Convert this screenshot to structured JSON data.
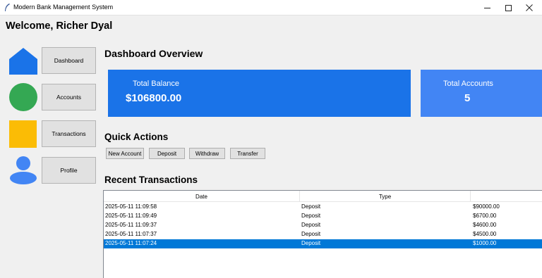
{
  "window": {
    "title": "Modern Bank Management System"
  },
  "welcome": "Welcome, Richer Dyal",
  "sidebar": {
    "items": [
      {
        "label": "Dashboard",
        "icon": "home-icon",
        "color": "#1a73e8"
      },
      {
        "label": "Accounts",
        "icon": "circle-icon",
        "color": "#34a853"
      },
      {
        "label": "Transactions",
        "icon": "square-icon",
        "color": "#fbbc05"
      },
      {
        "label": "Profile",
        "icon": "user-icon",
        "color": "#4285f4"
      }
    ]
  },
  "dashboard": {
    "title": "Dashboard Overview",
    "cards": [
      {
        "label": "Total Balance",
        "value": "$106800.00",
        "color": "#1a73e8"
      },
      {
        "label": "Total Accounts",
        "value": "5",
        "color": "#4285f4"
      }
    ]
  },
  "quick_actions": {
    "title": "Quick Actions",
    "buttons": [
      "New Account",
      "Deposit",
      "Withdraw",
      "Transfer"
    ]
  },
  "recent": {
    "title": "Recent Transactions",
    "columns": [
      "Date",
      "Type",
      ""
    ],
    "rows": [
      {
        "date": "2025-05-11 11:09:58",
        "type": "Deposit",
        "amount": "$90000.00",
        "selected": false
      },
      {
        "date": "2025-05-11 11:09:49",
        "type": "Deposit",
        "amount": "$6700.00",
        "selected": false
      },
      {
        "date": "2025-05-11 11:09:37",
        "type": "Deposit",
        "amount": "$4600.00",
        "selected": false
      },
      {
        "date": "2025-05-11 11:07:37",
        "type": "Deposit",
        "amount": "$4500.00",
        "selected": false
      },
      {
        "date": "2025-05-11 11:07:24",
        "type": "Deposit",
        "amount": "$1000.00",
        "selected": true
      }
    ],
    "selection_color": "#0078d7"
  }
}
